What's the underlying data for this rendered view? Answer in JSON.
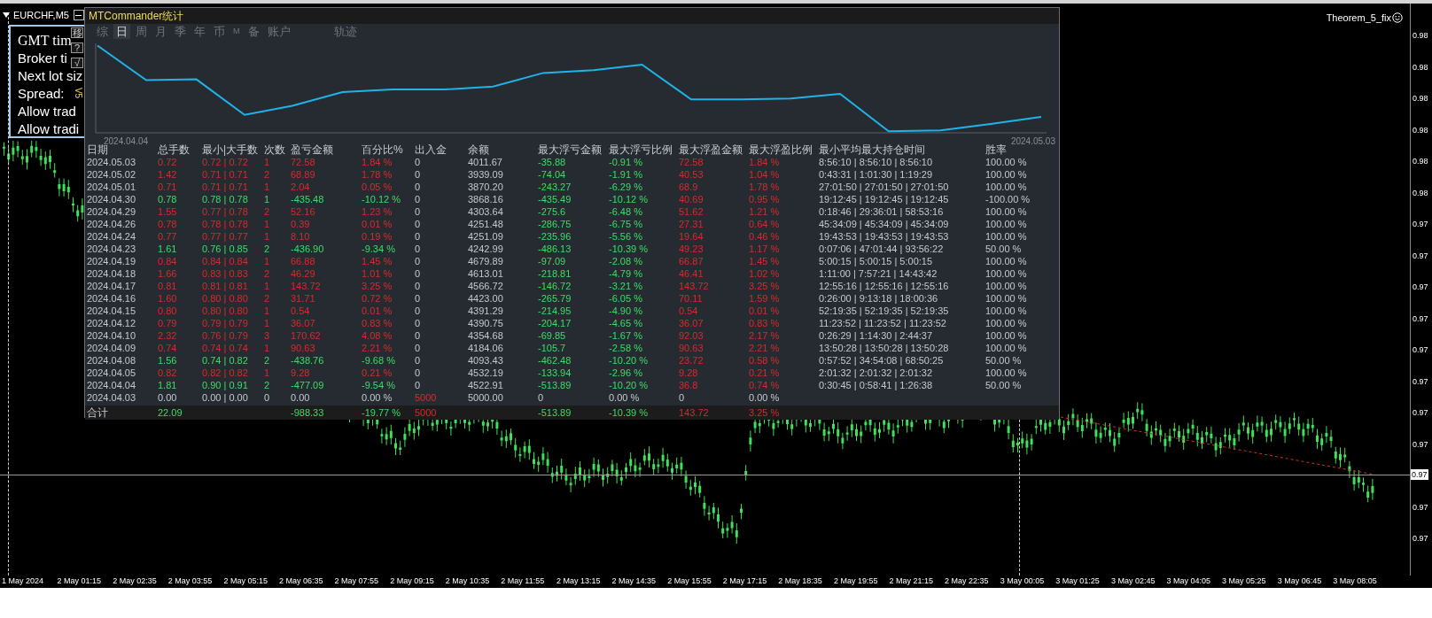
{
  "chart_window": {
    "symbol": "EURCHF,M5",
    "indicator": "Theorem_5_fix",
    "price_labels": [
      "0.98",
      "0.98",
      "0.98",
      "0.98",
      "0.98",
      "0.98",
      "0.97",
      "0.97",
      "0.97",
      "0.97",
      "0.97",
      "0.97",
      "0.97",
      "0.97",
      "0.97",
      "0.97"
    ],
    "current_price": "0.97",
    "time_labels": [
      "1 May 2024",
      "2 May 01:15",
      "2 May 02:35",
      "2 May 03:55",
      "2 May 05:15",
      "2 May 06:35",
      "2 May 07:55",
      "2 May 09:15",
      "2 May 10:35",
      "2 May 11:55",
      "2 May 13:15",
      "2 May 14:35",
      "2 May 15:55",
      "2 May 17:15",
      "2 May 18:35",
      "2 May 19:55",
      "2 May 21:15",
      "2 May 22:35",
      "3 May 00:05",
      "3 May 01:25",
      "3 May 02:45",
      "3 May 04:05",
      "3 May 05:25",
      "3 May 06:45",
      "3 May 08:05"
    ]
  },
  "info_panel": {
    "lines": [
      "GMT tim",
      "Broker ti",
      "Next lot siz",
      "Spread:",
      "Allow trad",
      "Allow tradi"
    ],
    "buttons": [
      "移",
      "?",
      "√"
    ],
    "version": "V5"
  },
  "stats_window": {
    "title": "MTCommander统计",
    "tabs": [
      {
        "label": "综",
        "selected": false
      },
      {
        "label": "日",
        "selected": true
      },
      {
        "label": "周",
        "selected": false
      },
      {
        "label": "月",
        "selected": false
      },
      {
        "label": "季",
        "selected": false
      },
      {
        "label": "年",
        "selected": false
      },
      {
        "label": "币",
        "selected": false
      },
      {
        "label": "M",
        "selected": false
      },
      {
        "label": "备",
        "selected": false
      },
      {
        "label": "账户",
        "selected": false
      }
    ],
    "track_tab": {
      "label": "轨迹",
      "selected": false
    },
    "equity_chart": {
      "start_label": "2024.04.04",
      "end_label": "2024.05.03"
    },
    "table": {
      "columns": [
        "日期",
        "总手数",
        "最小|大手数",
        "次数",
        "盈亏金额",
        "百分比%",
        "出入金",
        "余额",
        "最大浮亏金额",
        "最大浮亏比例",
        "最大浮盈金额",
        "最大浮盈比例",
        "最小平均最大持仓时间",
        "胜率"
      ],
      "rows": [
        {
          "kind": "profit",
          "deposit_highlight": false,
          "cells": [
            "2024.05.03",
            "0.72",
            "0.72 | 0.72",
            "1",
            "72.58",
            "1.84 %",
            "0",
            "4011.67",
            "-35.88",
            "-0.91 %",
            "72.58",
            "1.84 %",
            "8:56:10 | 8:56:10 | 8:56:10",
            "100.00 %"
          ]
        },
        {
          "kind": "profit",
          "deposit_highlight": false,
          "cells": [
            "2024.05.02",
            "1.42",
            "0.71 | 0.71",
            "2",
            "68.89",
            "1.78 %",
            "0",
            "3939.09",
            "-74.04",
            "-1.91 %",
            "40.53",
            "1.04 %",
            "0:43:31 | 1:01:30 | 1:19:29",
            "100.00 %"
          ]
        },
        {
          "kind": "profit",
          "deposit_highlight": false,
          "cells": [
            "2024.05.01",
            "0.71",
            "0.71 | 0.71",
            "1",
            "2.04",
            "0.05 %",
            "0",
            "3870.20",
            "-243.27",
            "-6.29 %",
            "68.9",
            "1.78 %",
            "27:01:50 | 27:01:50 | 27:01:50",
            "100.00 %"
          ]
        },
        {
          "kind": "loss",
          "deposit_highlight": false,
          "cells": [
            "2024.04.30",
            "0.78",
            "0.78 | 0.78",
            "1",
            "-435.48",
            "-10.12 %",
            "0",
            "3868.16",
            "-435.49",
            "-10.12 %",
            "40.69",
            "0.95 %",
            "19:12:45 | 19:12:45 | 19:12:45",
            "-100.00 %"
          ]
        },
        {
          "kind": "profit",
          "deposit_highlight": false,
          "cells": [
            "2024.04.29",
            "1.55",
            "0.77 | 0.78",
            "2",
            "52.16",
            "1.23 %",
            "0",
            "4303.64",
            "-275.6",
            "-6.48 %",
            "51.62",
            "1.21 %",
            "0:18:46 | 29:36:01 | 58:53:16",
            "100.00 %"
          ]
        },
        {
          "kind": "profit",
          "deposit_highlight": false,
          "cells": [
            "2024.04.26",
            "0.78",
            "0.78 | 0.78",
            "1",
            "0.39",
            "0.01 %",
            "0",
            "4251.48",
            "-286.75",
            "-6.75 %",
            "27.31",
            "0.64 %",
            "45:34:09 | 45:34:09 | 45:34:09",
            "100.00 %"
          ]
        },
        {
          "kind": "profit",
          "deposit_highlight": false,
          "cells": [
            "2024.04.24",
            "0.77",
            "0.77 | 0.77",
            "1",
            "8.10",
            "0.19 %",
            "0",
            "4251.09",
            "-235.96",
            "-5.56 %",
            "19.64",
            "0.46 %",
            "19:43:53 | 19:43:53 | 19:43:53",
            "100.00 %"
          ]
        },
        {
          "kind": "loss",
          "deposit_highlight": false,
          "cells": [
            "2024.04.23",
            "1.61",
            "0.76 | 0.85",
            "2",
            "-436.90",
            "-9.34 %",
            "0",
            "4242.99",
            "-486.13",
            "-10.39 %",
            "49.23",
            "1.17 %",
            "0:07:06 | 47:01:44 | 93:56:22",
            "50.00 %"
          ]
        },
        {
          "kind": "profit",
          "deposit_highlight": false,
          "cells": [
            "2024.04.19",
            "0.84",
            "0.84 | 0.84",
            "1",
            "66.88",
            "1.45 %",
            "0",
            "4679.89",
            "-97.09",
            "-2.08 %",
            "66.87",
            "1.45 %",
            "5:00:15 | 5:00:15 | 5:00:15",
            "100.00 %"
          ]
        },
        {
          "kind": "profit",
          "deposit_highlight": false,
          "cells": [
            "2024.04.18",
            "1.66",
            "0.83 | 0.83",
            "2",
            "46.29",
            "1.01 %",
            "0",
            "4613.01",
            "-218.81",
            "-4.79 %",
            "46.41",
            "1.02 %",
            "1:11:00 | 7:57:21 | 14:43:42",
            "100.00 %"
          ]
        },
        {
          "kind": "profit",
          "deposit_highlight": false,
          "cells": [
            "2024.04.17",
            "0.81",
            "0.81 | 0.81",
            "1",
            "143.72",
            "3.25 %",
            "0",
            "4566.72",
            "-146.72",
            "-3.21 %",
            "143.72",
            "3.25 %",
            "12:55:16 | 12:55:16 | 12:55:16",
            "100.00 %"
          ]
        },
        {
          "kind": "profit",
          "deposit_highlight": false,
          "cells": [
            "2024.04.16",
            "1.60",
            "0.80 | 0.80",
            "2",
            "31.71",
            "0.72 %",
            "0",
            "4423.00",
            "-265.79",
            "-6.05 %",
            "70.11",
            "1.59 %",
            "0:26:00 | 9:13:18 | 18:00:36",
            "100.00 %"
          ]
        },
        {
          "kind": "profit",
          "deposit_highlight": false,
          "cells": [
            "2024.04.15",
            "0.80",
            "0.80 | 0.80",
            "1",
            "0.54",
            "0.01 %",
            "0",
            "4391.29",
            "-214.95",
            "-4.90 %",
            "0.54",
            "0.01 %",
            "52:19:35 | 52:19:35 | 52:19:35",
            "100.00 %"
          ]
        },
        {
          "kind": "profit",
          "deposit_highlight": false,
          "cells": [
            "2024.04.12",
            "0.79",
            "0.79 | 0.79",
            "1",
            "36.07",
            "0.83 %",
            "0",
            "4390.75",
            "-204.17",
            "-4.65 %",
            "36.07",
            "0.83 %",
            "11:23:52 | 11:23:52 | 11:23:52",
            "100.00 %"
          ]
        },
        {
          "kind": "profit",
          "deposit_highlight": false,
          "cells": [
            "2024.04.10",
            "2.32",
            "0.76 | 0.79",
            "3",
            "170.62",
            "4.08 %",
            "0",
            "4354.68",
            "-69.85",
            "-1.67 %",
            "92.03",
            "2.17 %",
            "0:26:29 | 1:14:30 | 2:44:37",
            "100.00 %"
          ]
        },
        {
          "kind": "profit",
          "deposit_highlight": false,
          "cells": [
            "2024.04.09",
            "0.74",
            "0.74 | 0.74",
            "1",
            "90.63",
            "2.21 %",
            "0",
            "4184.06",
            "-105.7",
            "-2.58 %",
            "90.63",
            "2.21 %",
            "13:50:28 | 13:50:28 | 13:50:28",
            "100.00 %"
          ]
        },
        {
          "kind": "loss",
          "deposit_highlight": false,
          "cells": [
            "2024.04.08",
            "1.56",
            "0.74 | 0.82",
            "2",
            "-438.76",
            "-9.68 %",
            "0",
            "4093.43",
            "-462.48",
            "-10.20 %",
            "23.72",
            "0.58 %",
            "0:57:52 | 34:54:08 | 68:50:25",
            "50.00 %"
          ]
        },
        {
          "kind": "profit",
          "deposit_highlight": false,
          "cells": [
            "2024.04.05",
            "0.82",
            "0.82 | 0.82",
            "1",
            "9.28",
            "0.21 %",
            "0",
            "4532.19",
            "-133.94",
            "-2.96 %",
            "9.28",
            "0.21 %",
            "2:01:32 | 2:01:32 | 2:01:32",
            "100.00 %"
          ]
        },
        {
          "kind": "loss",
          "deposit_highlight": false,
          "cells": [
            "2024.04.04",
            "1.81",
            "0.90 | 0.91",
            "2",
            "-477.09",
            "-9.54 %",
            "0",
            "4522.91",
            "-513.89",
            "-10.20 %",
            "36.8",
            "0.74 %",
            "0:30:45 | 0:58:41 | 1:26:38",
            "50.00 %"
          ]
        },
        {
          "kind": "flat",
          "deposit_highlight": true,
          "cells": [
            "2024.04.03",
            "0.00",
            "0.00 | 0.00",
            "0",
            "0.00",
            "0.00 %",
            "5000",
            "5000.00",
            "0",
            "0.00 %",
            "0",
            "0.00 %"
          ]
        }
      ],
      "total": {
        "kind": "loss",
        "deposit_highlight": true,
        "label": "合计",
        "total_lots": "22.09",
        "pnl": "-988.33",
        "percent": "-19.77 %",
        "deposit": "5000",
        "max_float_loss": "-513.89",
        "max_float_loss_pct": "-10.39 %",
        "max_float_profit": "143.72",
        "max_float_profit_pct": "3.25 %"
      }
    }
  }
}
